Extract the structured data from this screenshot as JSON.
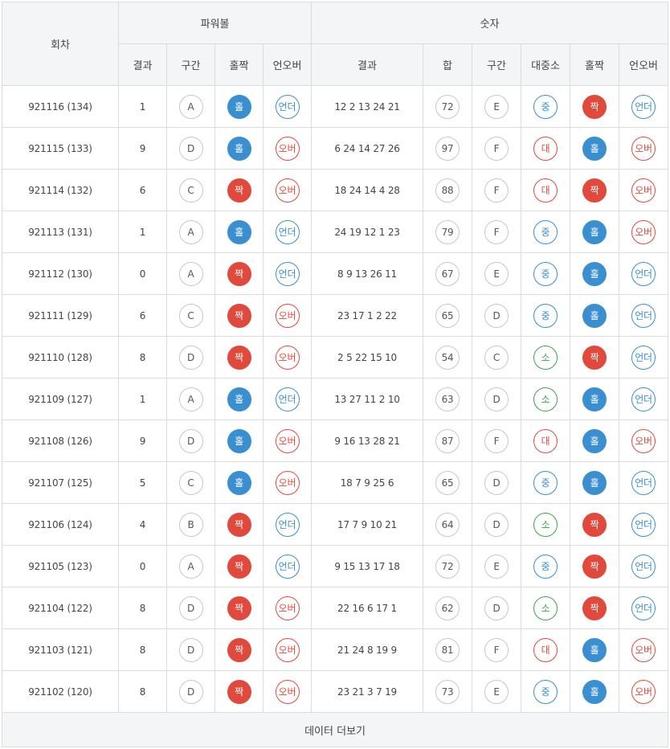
{
  "header": {
    "round": "회차",
    "powerball": "파워볼",
    "numbers": "숫자",
    "pb_result": "결과",
    "pb_section": "구간",
    "pb_oddeven": "홀짝",
    "pb_underover": "언오버",
    "num_result": "결과",
    "num_sum": "합",
    "num_section": "구간",
    "num_size": "대중소",
    "num_oddeven": "홀짝",
    "num_underover": "언오버"
  },
  "colors": {
    "blue": "#3a8fd0",
    "red": "#e0493c",
    "green": "#3fa34d",
    "gray": "#c7c7c7",
    "header_bg": "#f4f5f7"
  },
  "rows": [
    {
      "round": "921116 (134)",
      "pb": "1",
      "pb_sec": "A",
      "pb_oe": "홀",
      "pb_uo": "언더",
      "nums": "12 2 13 24 21",
      "sum": "72",
      "sec": "E",
      "size": "중",
      "oe": "짝",
      "uo": "언더"
    },
    {
      "round": "921115 (133)",
      "pb": "9",
      "pb_sec": "D",
      "pb_oe": "홀",
      "pb_uo": "오버",
      "nums": "6 24 14 27 26",
      "sum": "97",
      "sec": "F",
      "size": "대",
      "oe": "홀",
      "uo": "오버"
    },
    {
      "round": "921114 (132)",
      "pb": "6",
      "pb_sec": "C",
      "pb_oe": "짝",
      "pb_uo": "오버",
      "nums": "18 24 14 4 28",
      "sum": "88",
      "sec": "F",
      "size": "대",
      "oe": "짝",
      "uo": "오버"
    },
    {
      "round": "921113 (131)",
      "pb": "1",
      "pb_sec": "A",
      "pb_oe": "홀",
      "pb_uo": "언더",
      "nums": "24 19 12 1 23",
      "sum": "79",
      "sec": "F",
      "size": "중",
      "oe": "홀",
      "uo": "오버"
    },
    {
      "round": "921112 (130)",
      "pb": "0",
      "pb_sec": "A",
      "pb_oe": "짝",
      "pb_uo": "언더",
      "nums": "8 9 13 26 11",
      "sum": "67",
      "sec": "E",
      "size": "중",
      "oe": "홀",
      "uo": "언더"
    },
    {
      "round": "921111 (129)",
      "pb": "6",
      "pb_sec": "C",
      "pb_oe": "짝",
      "pb_uo": "오버",
      "nums": "23 17 1 2 22",
      "sum": "65",
      "sec": "D",
      "size": "중",
      "oe": "홀",
      "uo": "언더"
    },
    {
      "round": "921110 (128)",
      "pb": "8",
      "pb_sec": "D",
      "pb_oe": "짝",
      "pb_uo": "오버",
      "nums": "2 5 22 15 10",
      "sum": "54",
      "sec": "C",
      "size": "소",
      "oe": "짝",
      "uo": "언더"
    },
    {
      "round": "921109 (127)",
      "pb": "1",
      "pb_sec": "A",
      "pb_oe": "홀",
      "pb_uo": "언더",
      "nums": "13 27 11 2 10",
      "sum": "63",
      "sec": "D",
      "size": "소",
      "oe": "홀",
      "uo": "언더"
    },
    {
      "round": "921108 (126)",
      "pb": "9",
      "pb_sec": "D",
      "pb_oe": "홀",
      "pb_uo": "오버",
      "nums": "9 16 13 28 21",
      "sum": "87",
      "sec": "F",
      "size": "대",
      "oe": "홀",
      "uo": "오버"
    },
    {
      "round": "921107 (125)",
      "pb": "5",
      "pb_sec": "C",
      "pb_oe": "홀",
      "pb_uo": "오버",
      "nums": "18 7 9 25 6",
      "sum": "65",
      "sec": "D",
      "size": "중",
      "oe": "홀",
      "uo": "언더"
    },
    {
      "round": "921106 (124)",
      "pb": "4",
      "pb_sec": "B",
      "pb_oe": "짝",
      "pb_uo": "언더",
      "nums": "17 7 9 10 21",
      "sum": "64",
      "sec": "D",
      "size": "소",
      "oe": "짝",
      "uo": "언더"
    },
    {
      "round": "921105 (123)",
      "pb": "0",
      "pb_sec": "A",
      "pb_oe": "짝",
      "pb_uo": "언더",
      "nums": "9 15 13 17 18",
      "sum": "72",
      "sec": "E",
      "size": "중",
      "oe": "짝",
      "uo": "언더"
    },
    {
      "round": "921104 (122)",
      "pb": "8",
      "pb_sec": "D",
      "pb_oe": "짝",
      "pb_uo": "오버",
      "nums": "22 16 6 17 1",
      "sum": "62",
      "sec": "D",
      "size": "소",
      "oe": "짝",
      "uo": "언더"
    },
    {
      "round": "921103 (121)",
      "pb": "8",
      "pb_sec": "D",
      "pb_oe": "짝",
      "pb_uo": "오버",
      "nums": "21 24 8 19 9",
      "sum": "81",
      "sec": "F",
      "size": "대",
      "oe": "홀",
      "uo": "오버"
    },
    {
      "round": "921102 (120)",
      "pb": "8",
      "pb_sec": "D",
      "pb_oe": "짝",
      "pb_uo": "오버",
      "nums": "23 21 3 7 19",
      "sum": "73",
      "sec": "E",
      "size": "중",
      "oe": "홀",
      "uo": "오버"
    }
  ],
  "more_button": "데이터 더보기"
}
